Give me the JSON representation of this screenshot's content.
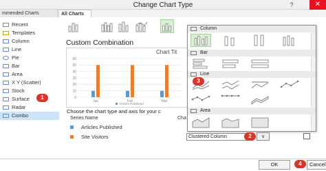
{
  "window": {
    "title": "Change Chart Type",
    "help": "?",
    "close": "✕"
  },
  "tabs": [
    {
      "label": "mmended Charts"
    },
    {
      "label": "All Charts"
    }
  ],
  "left_list": {
    "items": [
      {
        "label": "Recent"
      },
      {
        "label": "Templates"
      },
      {
        "label": "Column"
      },
      {
        "label": "Line"
      },
      {
        "label": "Pie"
      },
      {
        "label": "Bar"
      },
      {
        "label": "Area"
      },
      {
        "label": "X Y (Scatter)"
      },
      {
        "label": "Stock"
      },
      {
        "label": "Surface"
      },
      {
        "label": "Radar"
      },
      {
        "label": "Combo"
      }
    ],
    "selected": "Combo"
  },
  "badges": {
    "one": "1",
    "two": "2",
    "three": "3",
    "four": "4"
  },
  "combo": {
    "heading": "Custom Combination",
    "chart_title": "Chart Tit",
    "choose_text": "Choose the chart type and axis for your c",
    "table_headers": {
      "series_name": "Series Name",
      "chart_type": "Cha"
    },
    "series": [
      {
        "name": "Articles Published",
        "color": "#5b9bd5"
      },
      {
        "name": "Site Visitors",
        "color": "#ed7d31"
      }
    ],
    "selected_type": "Clustered Column",
    "dropdown_arrow": "∨"
  },
  "chart_data": {
    "type": "bar",
    "categories": [
      "Jan",
      "Feb",
      "Mar"
    ],
    "series": [
      {
        "name": "Articles Published",
        "values": [
          10,
          10,
          10
        ]
      },
      {
        "name": "Site Visitors",
        "values": [
          50,
          50,
          50
        ]
      }
    ],
    "ylim": [
      0,
      60
    ],
    "yticks": [
      0,
      10,
      20,
      30,
      40,
      50,
      60
    ],
    "legend": "bottom",
    "grid": true
  },
  "dropdown": {
    "sections": [
      {
        "label": "Column"
      },
      {
        "label": "Bar"
      },
      {
        "label": "Line"
      },
      {
        "label": "Area"
      }
    ]
  },
  "footer": {
    "ok": "OK",
    "cancel": "Cancel"
  }
}
